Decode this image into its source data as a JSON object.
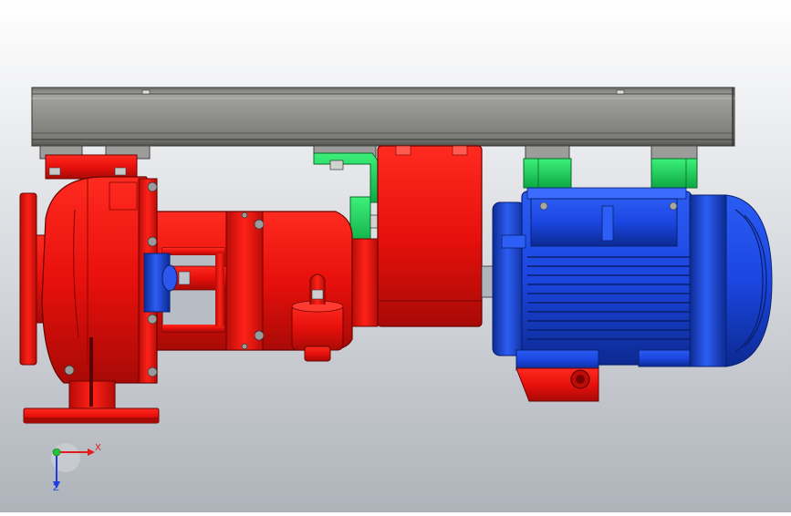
{
  "viewport": {
    "background_top": "#ffffff",
    "background_bottom": "#aeb3ba"
  },
  "colors": {
    "pump_red": "#e8100c",
    "pump_red_dark": "#a50a06",
    "motor_blue": "#1b46e0",
    "motor_blue_dark": "#0c2a92",
    "rail_gray": "#8d8e8a",
    "rail_dark": "#4b4c49",
    "bracket_green": "#18e05a",
    "bracket_green_dark": "#0e9a3c",
    "mount_gray": "#9c9d9a"
  },
  "triad": {
    "x_label": "X",
    "z_label": "Z",
    "x_color": "#e01c1c",
    "z_color": "#1c3ee0",
    "y_color": "#22c43a"
  }
}
